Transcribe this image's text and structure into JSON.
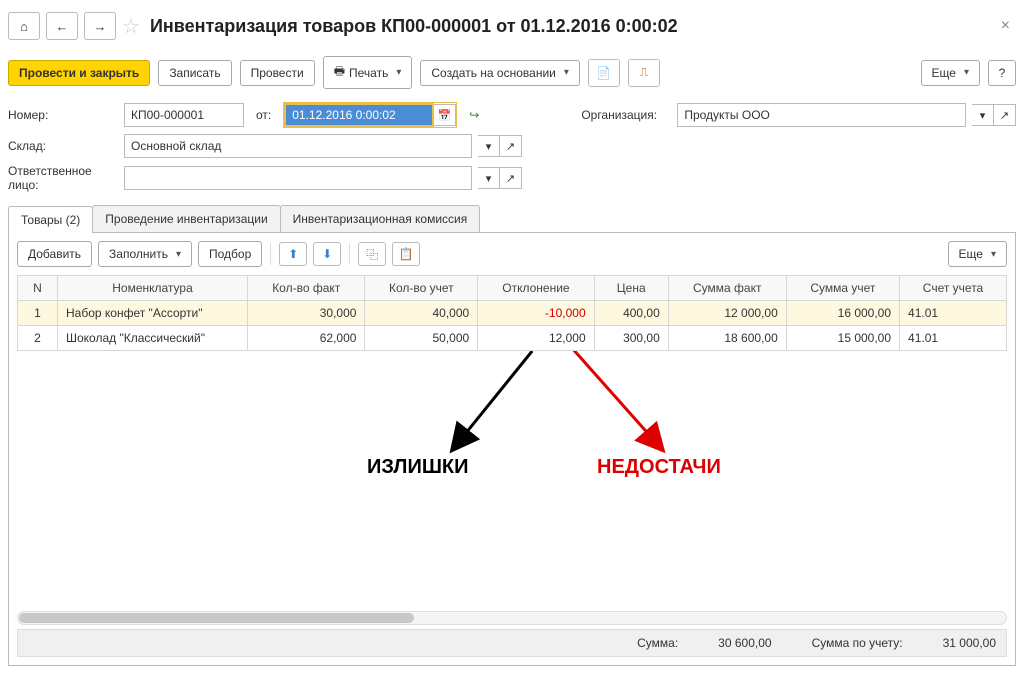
{
  "title": "Инвентаризация товаров КП00-000001 от 01.12.2016 0:00:02",
  "toolbar": {
    "post_close": "Провести и закрыть",
    "save": "Записать",
    "post": "Провести",
    "print": "Печать",
    "create_based": "Создать на основании",
    "more": "Еще",
    "help": "?"
  },
  "form": {
    "number_label": "Номер:",
    "number": "КП00-000001",
    "from_label": "от:",
    "date": "01.12.2016  0:00:02",
    "org_label": "Организация:",
    "org": "Продукты ООО",
    "warehouse_label": "Склад:",
    "warehouse": "Основной склад",
    "responsible_label": "Ответственное лицо:",
    "responsible": ""
  },
  "tabs": {
    "goods": "Товары (2)",
    "inv_process": "Проведение инвентаризации",
    "commission": "Инвентаризационная комиссия"
  },
  "tab_toolbar": {
    "add": "Добавить",
    "fill": "Заполнить",
    "pickup": "Подбор",
    "more": "Еще"
  },
  "grid": {
    "headers": {
      "n": "N",
      "nomen": "Номенклатура",
      "qty_fact": "Кол-во факт",
      "qty_acc": "Кол-во учет",
      "deviation": "Отклонение",
      "price": "Цена",
      "sum_fact": "Сумма факт",
      "sum_acc": "Сумма учет",
      "account": "Счет учета"
    },
    "rows": [
      {
        "n": "1",
        "nomen": "Набор конфет \"Ассорти\"",
        "qf": "30,000",
        "qa": "40,000",
        "dev": "-10,000",
        "price": "400,00",
        "sf": "12 000,00",
        "sa": "16 000,00",
        "acc": "41.01"
      },
      {
        "n": "2",
        "nomen": "Шоколад \"Классический\"",
        "qf": "62,000",
        "qa": "50,000",
        "dev": "12,000",
        "price": "300,00",
        "sf": "18 600,00",
        "sa": "15 000,00",
        "acc": "41.01"
      }
    ]
  },
  "footer": {
    "sum_label": "Сумма:",
    "sum": "30 600,00",
    "sum_acc_label": "Сумма по учету:",
    "sum_acc": "31 000,00"
  },
  "annotations": {
    "surplus": "ИЗЛИШКИ",
    "shortage": "НЕДОСТАЧИ"
  }
}
